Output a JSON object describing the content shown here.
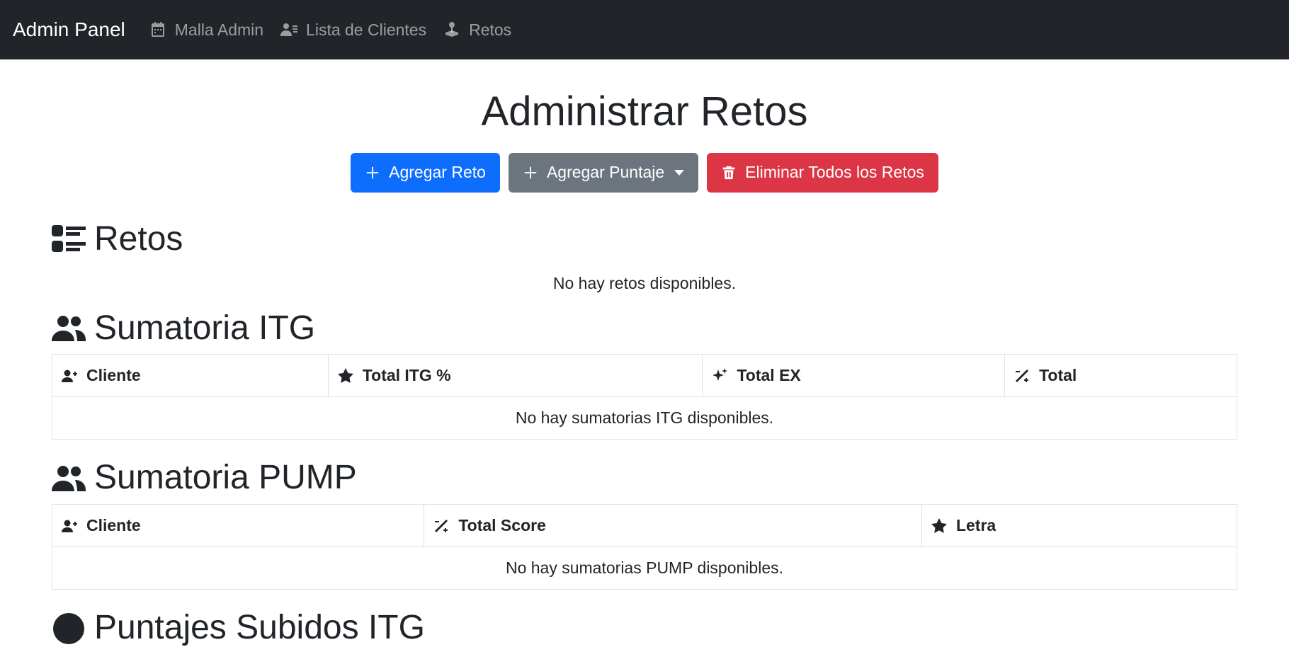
{
  "navbar": {
    "brand": "Admin Panel",
    "links": [
      {
        "label": "Malla Admin",
        "icon": "calendar-icon"
      },
      {
        "label": "Lista de Clientes",
        "icon": "user-list-icon"
      },
      {
        "label": "Retos",
        "icon": "joystick-icon"
      }
    ]
  },
  "page": {
    "title": "Administrar Retos"
  },
  "actions": {
    "add_challenge": "Agregar Reto",
    "add_score": "Agregar Puntaje",
    "delete_all": "Eliminar Todos los Retos"
  },
  "retos": {
    "title": "Retos",
    "empty": "No hay retos disponibles."
  },
  "itg": {
    "title": "Sumatoria ITG",
    "headers": [
      "Cliente",
      "Total ITG %",
      "Total EX",
      "Total"
    ],
    "empty": "No hay sumatorias ITG disponibles."
  },
  "pump": {
    "title": "Sumatoria PUMP",
    "headers": [
      "Cliente",
      "Total Score",
      "Letra"
    ],
    "empty": "No hay sumatorias PUMP disponibles."
  },
  "next_section": {
    "title": "Puntajes Subidos ITG"
  },
  "colors": {
    "navbar": "#212529",
    "primary": "#0d6efd",
    "secondary": "#6c757d",
    "danger": "#dc3545"
  }
}
